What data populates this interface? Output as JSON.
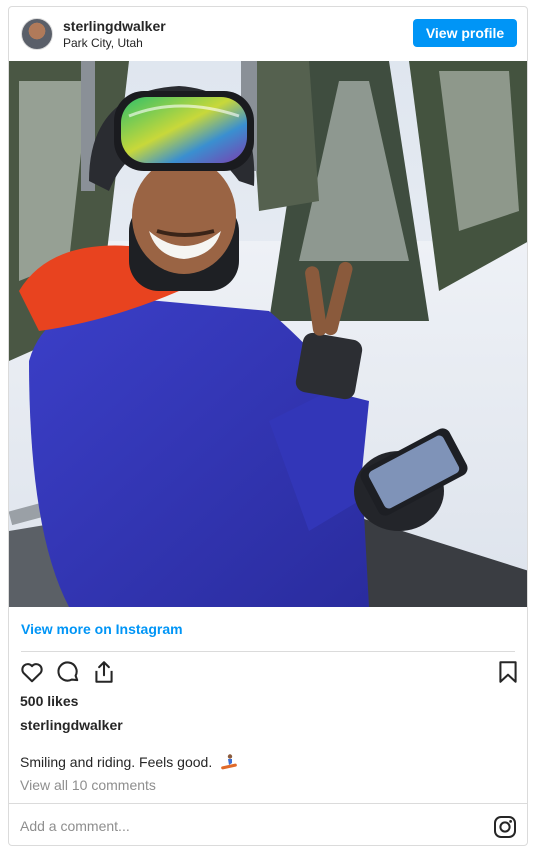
{
  "header": {
    "username": "sterlingdwalker",
    "location": "Park City, Utah",
    "view_profile_label": "View profile"
  },
  "post": {
    "view_more_label": "View more on Instagram",
    "likes": "500 likes",
    "caption_user": "sterlingdwalker",
    "caption_text": "Smiling and riding. Feels good.",
    "view_comments_label": "View all 10 comments",
    "comment_placeholder": "Add a comment..."
  },
  "icons": {
    "like": "heart-icon",
    "comment": "comment-icon",
    "share": "share-icon",
    "save": "bookmark-icon",
    "brand": "instagram-icon",
    "emoji": "snowboarder-emoji"
  },
  "colors": {
    "accent": "#0095f6",
    "text": "#262626",
    "muted": "#8e8e8e",
    "border": "#dbdbdb"
  }
}
